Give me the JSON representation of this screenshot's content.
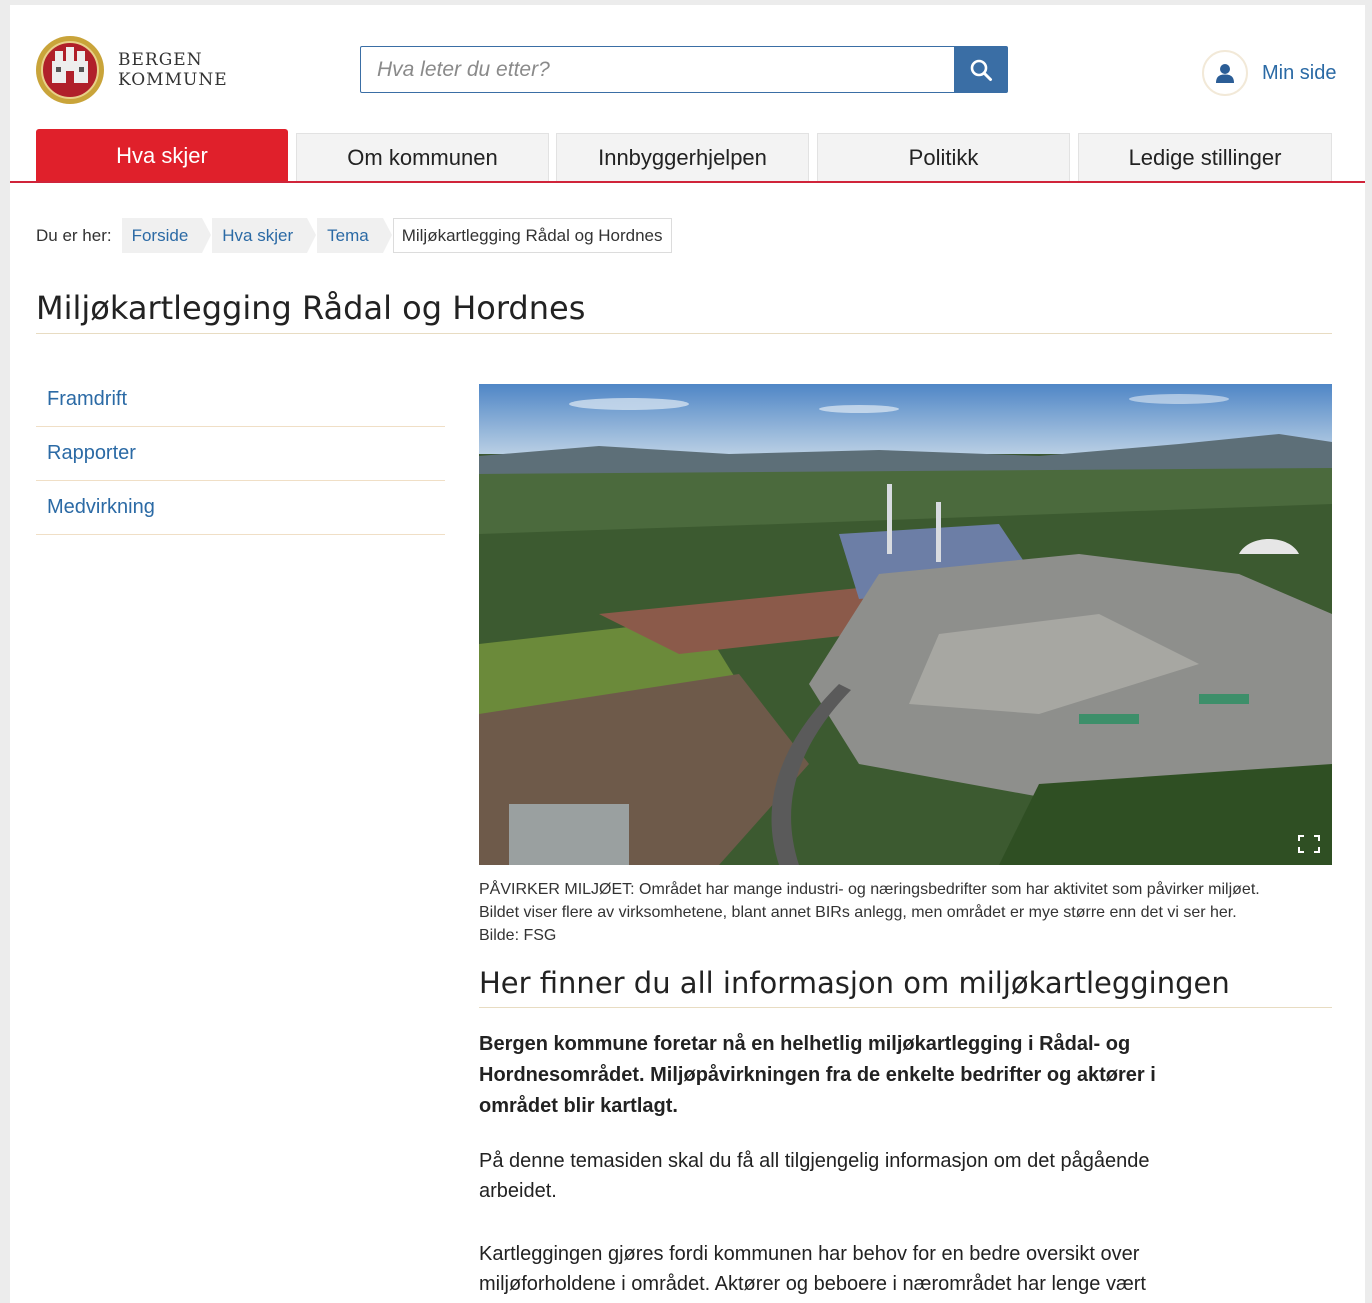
{
  "header": {
    "brand_line1": "BERGEN",
    "brand_line2": "KOMMUNE",
    "search_placeholder": "Hva leter du etter?",
    "search_icon": "search-icon",
    "user_icon": "user-icon",
    "min_side_label": "Min side"
  },
  "nav": {
    "tabs": [
      {
        "label": "Hva skjer",
        "active": true
      },
      {
        "label": "Om kommunen",
        "active": false
      },
      {
        "label": "Innbyggerhjelpen",
        "active": false
      },
      {
        "label": "Politikk",
        "active": false
      },
      {
        "label": "Ledige stillinger",
        "active": false
      }
    ]
  },
  "breadcrumb": {
    "lead": "Du er her:",
    "items": [
      "Forside",
      "Hva skjer",
      "Tema"
    ],
    "current": "Miljøkartlegging Rådal og Hordnes"
  },
  "page": {
    "title": "Miljøkartlegging Rådal og Hordnes"
  },
  "sidebar": {
    "items": [
      {
        "label": "Framdrift"
      },
      {
        "label": "Rapporter"
      },
      {
        "label": "Medvirkning"
      }
    ]
  },
  "main": {
    "photo_expand_icon": "expand-icon",
    "caption_line1": "PÅVIRKER MILJØET: Området har mange industri- og næringsbedrifter som har aktivitet som påvirker miljøet.",
    "caption_line2": "Bildet viser flere av virksomhetene, blant annet BIRs anlegg, men området er mye større enn det vi ser her.",
    "caption_line3": "Bilde: FSG",
    "heading": "Her finner du all informasjon om miljøkartleggingen",
    "lead": "Bergen kommune foretar nå en helhetlig miljøkartlegging i Rådal- og Hordnesområdet. Miljøpåvirkningen fra de enkelte bedrifter og aktører i området blir kartlagt.",
    "paragraph1": "På denne temasiden skal du få all tilgjengelig informasjon om det pågående arbeidet.",
    "paragraph2": "Kartleggingen gjøres fordi kommunen har behov for en bedre oversikt over miljøforholdene i området. Aktører og beboere i nærområdet har lenge vært"
  },
  "colors": {
    "accent_red": "#e0202b",
    "link_blue": "#2b6aa5",
    "search_blue": "#3a6ea5"
  }
}
